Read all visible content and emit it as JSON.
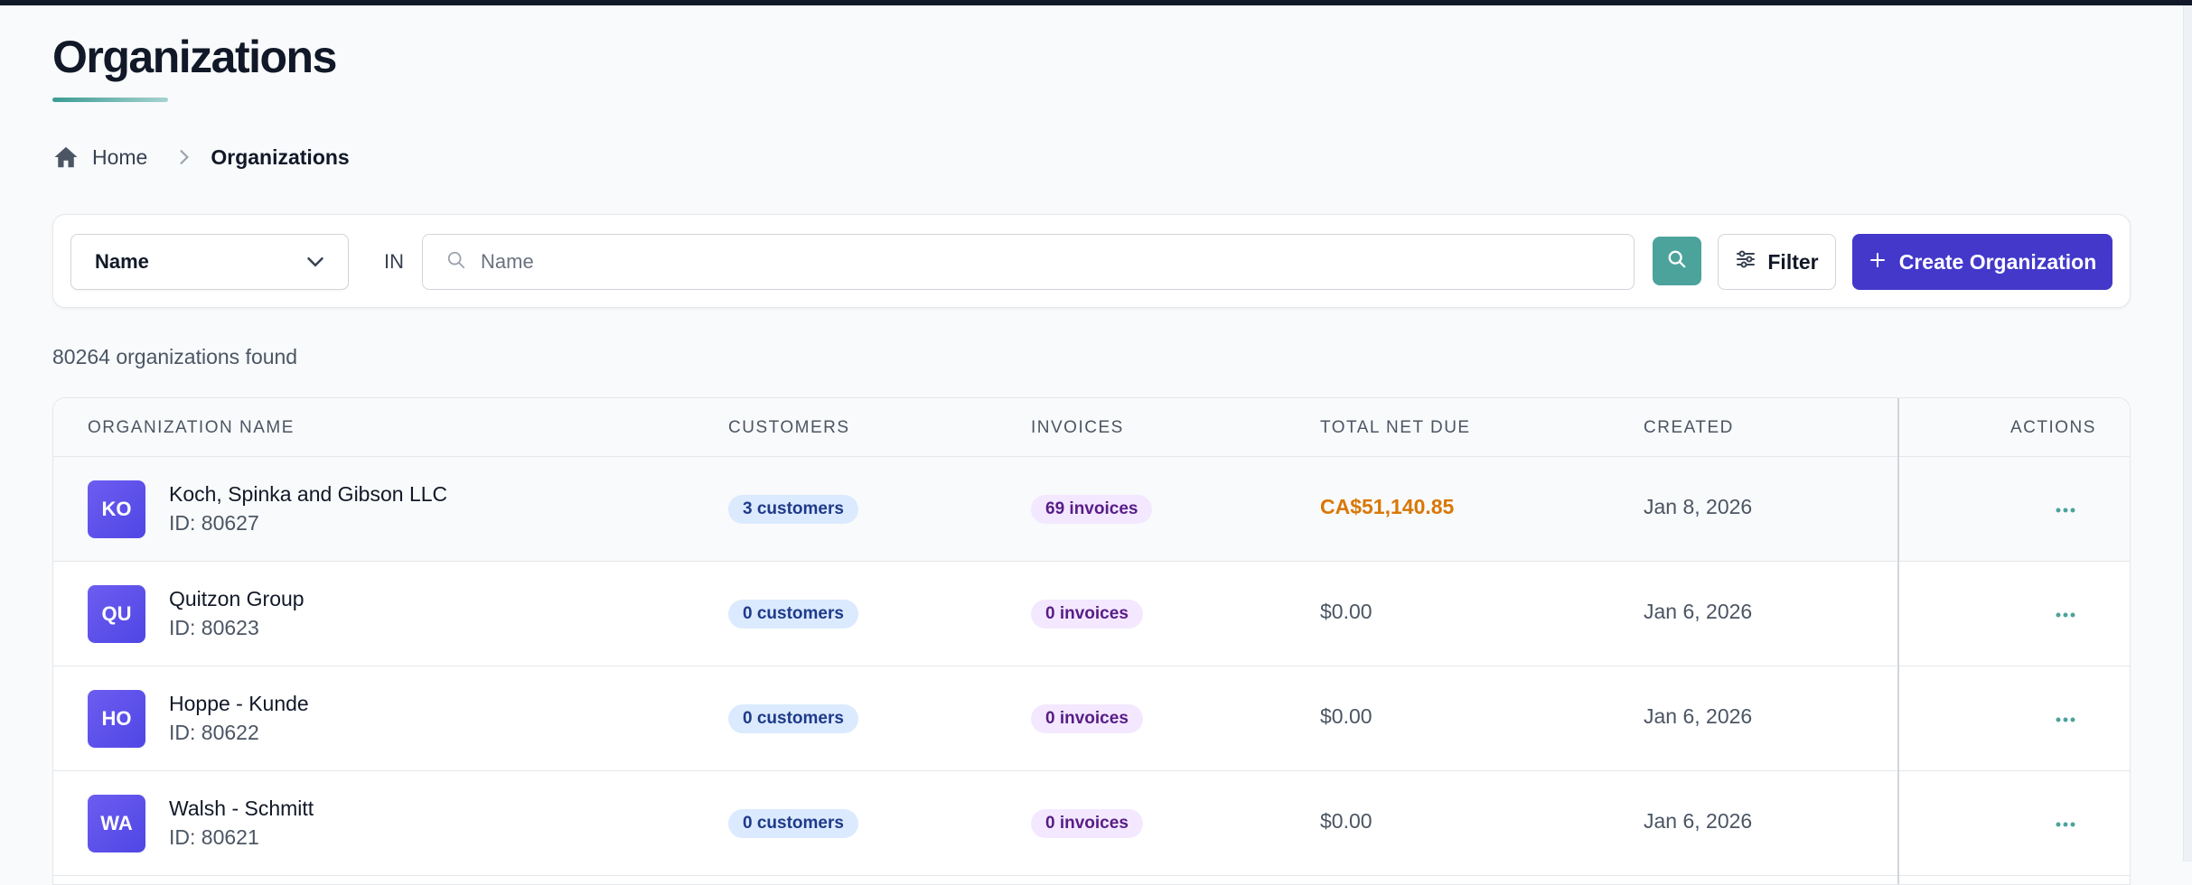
{
  "page": {
    "title": "Organizations"
  },
  "breadcrumb": {
    "home_label": "Home",
    "current_label": "Organizations"
  },
  "search": {
    "field_selected": "Name",
    "operator_label": "IN",
    "placeholder": "Name",
    "value": "",
    "filter_label": "Filter",
    "create_label": "Create Organization"
  },
  "results": {
    "count_text": "80264 organizations found"
  },
  "table": {
    "headers": {
      "name": "ORGANIZATION NAME",
      "customers": "CUSTOMERS",
      "invoices": "INVOICES",
      "net_due": "TOTAL NET DUE",
      "created": "CREATED",
      "actions": "ACTIONS"
    },
    "rows": [
      {
        "initials": "KO",
        "name": "Koch, Spinka and Gibson LLC",
        "id": "ID: 80627",
        "customers": "3 customers",
        "invoices": "69 invoices",
        "net_due": "CA$51,140.85",
        "created": "Jan 8, 2026"
      },
      {
        "initials": "QU",
        "name": "Quitzon Group",
        "id": "ID: 80623",
        "customers": "0 customers",
        "invoices": "0 invoices",
        "net_due": "$0.00",
        "created": "Jan 6, 2026"
      },
      {
        "initials": "HO",
        "name": "Hoppe - Kunde",
        "id": "ID: 80622",
        "customers": "0 customers",
        "invoices": "0 invoices",
        "net_due": "$0.00",
        "created": "Jan 6, 2026"
      },
      {
        "initials": "WA",
        "name": "Walsh - Schmitt",
        "id": "ID: 80621",
        "customers": "0 customers",
        "invoices": "0 invoices",
        "net_due": "$0.00",
        "created": "Jan 6, 2026"
      }
    ]
  },
  "colors": {
    "primary": "#4338ca",
    "accent_teal": "#4ca39c",
    "due_amount": "#d97706",
    "customer_badge_bg": "#dbeafe",
    "invoice_badge_bg": "#f3e8ff"
  },
  "icons": [
    "home-icon",
    "chevron-right-icon",
    "chevron-down-icon",
    "search-icon",
    "filter-icon",
    "plus-icon",
    "more-horizontal-icon"
  ]
}
